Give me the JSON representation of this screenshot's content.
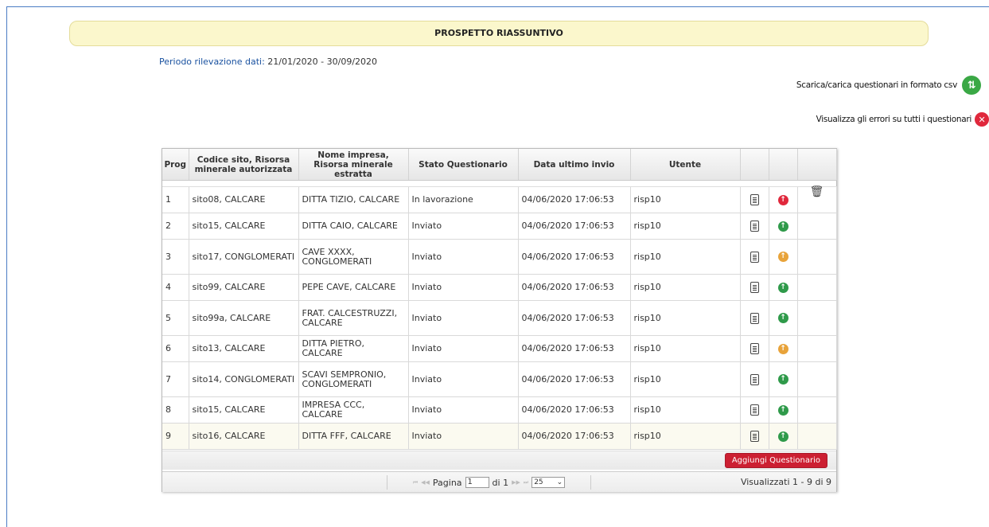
{
  "banner": {
    "title": "PROSPETTO RIASSUNTIVO"
  },
  "period": {
    "label": "Periodo rilevazione dati:",
    "value": "21/01/2020 - 30/09/2020"
  },
  "actions": {
    "csv_label": "Scarica/carica questionari in formato csv",
    "errors_label": "Visualizza gli errori su tutti i questionari"
  },
  "table": {
    "headers": {
      "prog": "Prog",
      "codice": "Codice sito, Risorsa minerale autorizzata",
      "nome": "Nome impresa, Risorsa minerale estratta",
      "stato": "Stato Questionario",
      "data": "Data ultimo invio",
      "utente": "Utente"
    },
    "rows": [
      {
        "prog": "1",
        "codice": "sito08, CALCARE",
        "nome": "DITTA TIZIO, CALCARE",
        "stato": "In lavorazione",
        "data": "04/06/2020 17:06:53",
        "utente": "risp10",
        "status_icon": "red-up-arrow-icon",
        "delete": true
      },
      {
        "prog": "2",
        "codice": "sito15, CALCARE",
        "nome": "DITTA CAIO, CALCARE",
        "stato": "Inviato",
        "data": "04/06/2020 17:06:53",
        "utente": "risp10",
        "status_icon": "green-up-arrow-icon",
        "delete": false
      },
      {
        "prog": "3",
        "codice": "sito17, CONGLOMERATI",
        "nome": "CAVE XXXX, CONGLOMERATI",
        "stato": "Inviato",
        "data": "04/06/2020 17:06:53",
        "utente": "risp10",
        "status_icon": "orange-up-arrow-icon",
        "delete": false
      },
      {
        "prog": "4",
        "codice": "sito99, CALCARE",
        "nome": "PEPE CAVE, CALCARE",
        "stato": "Inviato",
        "data": "04/06/2020 17:06:53",
        "utente": "risp10",
        "status_icon": "green-up-arrow-icon",
        "delete": false
      },
      {
        "prog": "5",
        "codice": "sito99a, CALCARE",
        "nome": "FRAT. CALCESTRUZZI, CALCARE",
        "stato": "Inviato",
        "data": "04/06/2020 17:06:53",
        "utente": "risp10",
        "status_icon": "green-up-arrow-icon",
        "delete": false
      },
      {
        "prog": "6",
        "codice": "sito13, CALCARE",
        "nome": "DITTA PIETRO, CALCARE",
        "stato": "Inviato",
        "data": "04/06/2020 17:06:53",
        "utente": "risp10",
        "status_icon": "orange-up-arrow-icon",
        "delete": false
      },
      {
        "prog": "7",
        "codice": "sito14, CONGLOMERATI",
        "nome": "SCAVI SEMPRONIO, CONGLOMERATI",
        "stato": "Inviato",
        "data": "04/06/2020 17:06:53",
        "utente": "risp10",
        "status_icon": "green-up-arrow-icon",
        "delete": false
      },
      {
        "prog": "8",
        "codice": "sito15, CALCARE",
        "nome": "IMPRESA CCC, CALCARE",
        "stato": "Inviato",
        "data": "04/06/2020 17:06:53",
        "utente": "risp10",
        "status_icon": "green-up-arrow-icon",
        "delete": false
      },
      {
        "prog": "9",
        "codice": "sito16, CALCARE",
        "nome": "DITTA FFF, CALCARE",
        "stato": "Inviato",
        "data": "04/06/2020 17:06:53",
        "utente": "risp10",
        "status_icon": "green-up-arrow-icon",
        "delete": false
      }
    ]
  },
  "footer": {
    "add_button": "Aggiungi Questionario",
    "page_label": "Pagina",
    "page_value": "1",
    "of_label": "di 1",
    "page_size": "25",
    "view_info": "Visualizzati 1 - 9 di 9"
  },
  "colors": {
    "accent_red": "#cc1f32",
    "green": "#2f9a4a",
    "orange": "#e8a33a",
    "banner": "#fbf7cc"
  }
}
